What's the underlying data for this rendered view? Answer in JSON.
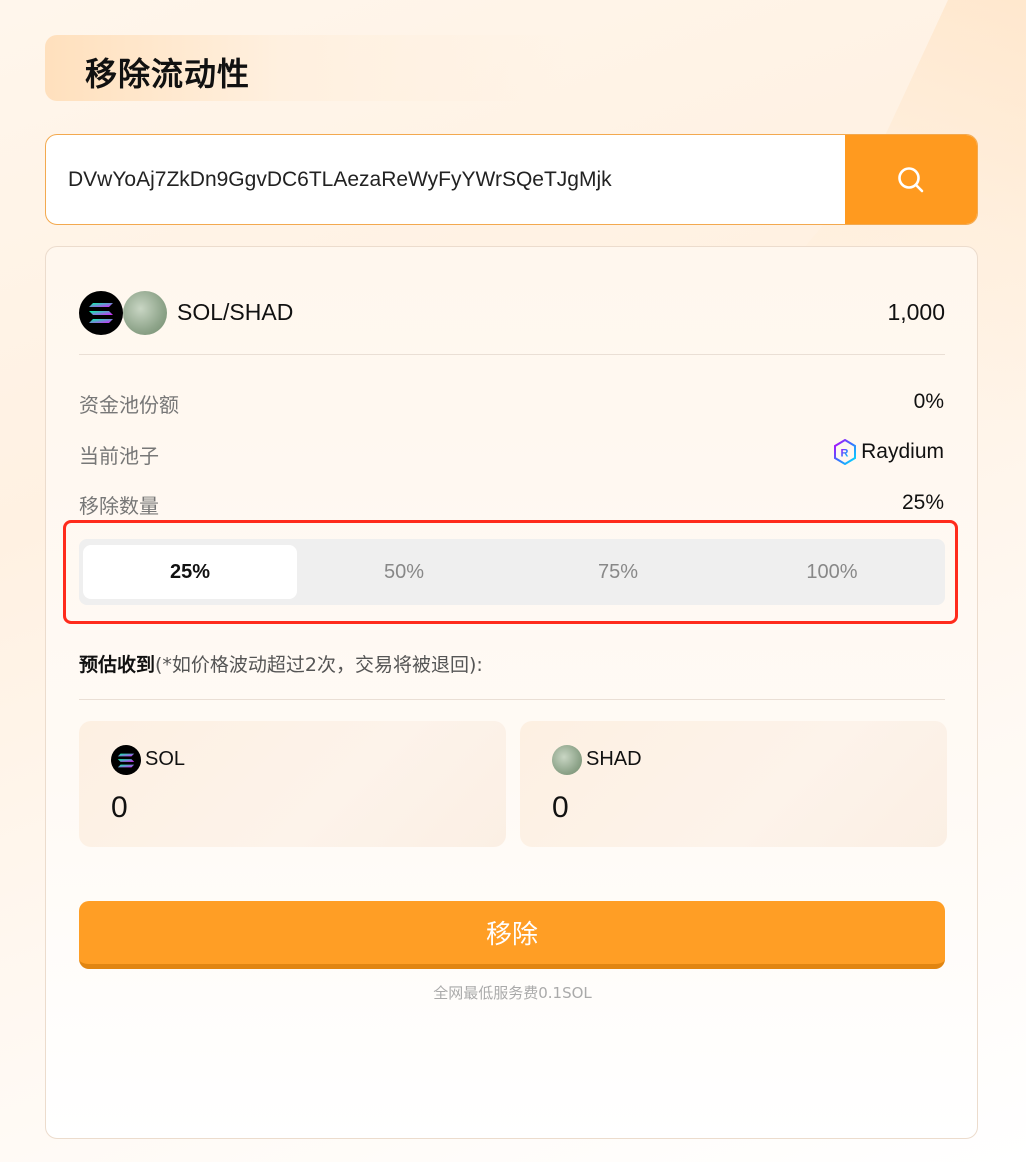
{
  "page": {
    "title": "移除流动性"
  },
  "search": {
    "value": "DVwYoAj7ZkDn9GgvDC6TLAezaReWyFyYWrSQeTJgMjk",
    "button_icon": "search-icon"
  },
  "pool": {
    "pair": "SOL/SHAD",
    "amount": "1,000",
    "info": {
      "share_label": "资金池份额",
      "share_value": "0%",
      "current_pool_label": "当前池子",
      "current_pool_value": "Raydium",
      "remove_amount_label": "移除数量",
      "remove_amount_value": "25%"
    },
    "percent_options": [
      "25%",
      "50%",
      "75%",
      "100%"
    ],
    "selected_percent": "25%"
  },
  "estimate": {
    "label_bold": "预估收到",
    "label_note": "(*如价格波动超过2次，交易将被退回):"
  },
  "tokens": [
    {
      "symbol": "SOL",
      "amount": "0",
      "icon": "solana-icon"
    },
    {
      "symbol": "SHAD",
      "amount": "0",
      "icon": "shad-token-icon"
    }
  ],
  "actions": {
    "remove_label": "移除",
    "fee_note": "全网最低服务费0.1SOL"
  },
  "colors": {
    "accent": "#ff9a1f",
    "highlight_border": "#ff2b1c"
  }
}
